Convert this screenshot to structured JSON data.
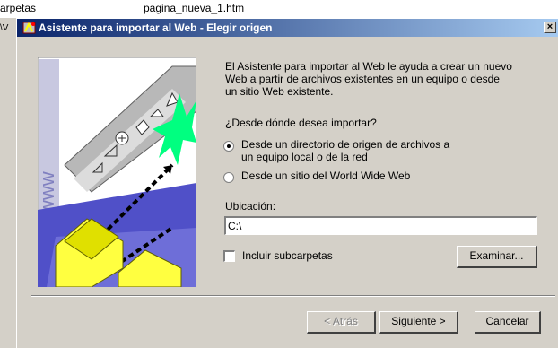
{
  "background": {
    "top_left_text": "arpetas",
    "top_right_text": "pagina_nueva_1.htm",
    "second_line_text": "\\V"
  },
  "window": {
    "title": "Asistente para importar al Web - Elegir origen",
    "close_label": "×",
    "title_gradient": [
      "#0a246a",
      "#a6caf0"
    ]
  },
  "wizard": {
    "intro": "El Asistente para importar al Web le ayuda a crear un nuevo Web a partir de archivos existentes en un equipo o desde un sitio Web existente.",
    "question": "¿Desde dónde desea importar?",
    "options": [
      {
        "label_line1": "Desde un directorio de origen de archivos a",
        "label_line2": "un equipo local o de la red",
        "checked": true
      },
      {
        "label_line1": "Desde un sitio del World Wide Web",
        "label_line2": "",
        "checked": false
      }
    ],
    "location_label": "Ubicación:",
    "location_value": "C:\\",
    "include_subfolders_label": "Incluir subcarpetas",
    "include_subfolders_checked": false,
    "browse_label": "Examinar..."
  },
  "footer": {
    "back_label": "< Atrás",
    "next_label": "Siguiente >",
    "cancel_label": "Cancelar"
  },
  "illustration": {
    "watermark_text": "http://www"
  }
}
